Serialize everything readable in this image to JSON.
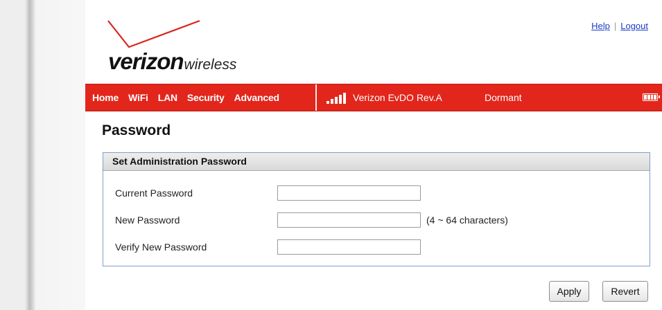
{
  "logo": {
    "brand": "verizon",
    "sub": "wireless"
  },
  "top_links": {
    "help": "Help",
    "separator": "|",
    "logout": "Logout"
  },
  "nav": {
    "items": [
      {
        "label": "Home"
      },
      {
        "label": "WiFi"
      },
      {
        "label": "LAN"
      },
      {
        "label": "Security"
      },
      {
        "label": "Advanced"
      }
    ],
    "signal_icon": "signal-bars-icon",
    "network_name": "Verizon  EvDO Rev.A",
    "connection_status": "Dormant",
    "battery_icon": "battery-icon"
  },
  "page": {
    "title": "Password"
  },
  "panel": {
    "title": "Set Administration Password",
    "fields": [
      {
        "label": "Current Password",
        "value": "",
        "hint": ""
      },
      {
        "label": "New Password",
        "value": "",
        "hint": "(4 ~ 64 characters)"
      },
      {
        "label": "Verify New Password",
        "value": "",
        "hint": ""
      }
    ]
  },
  "buttons": {
    "apply": "Apply",
    "revert": "Revert"
  },
  "colors": {
    "nav_red": "#e2261c",
    "link_blue": "#1a3cc8",
    "panel_border": "#7fa0c7"
  }
}
